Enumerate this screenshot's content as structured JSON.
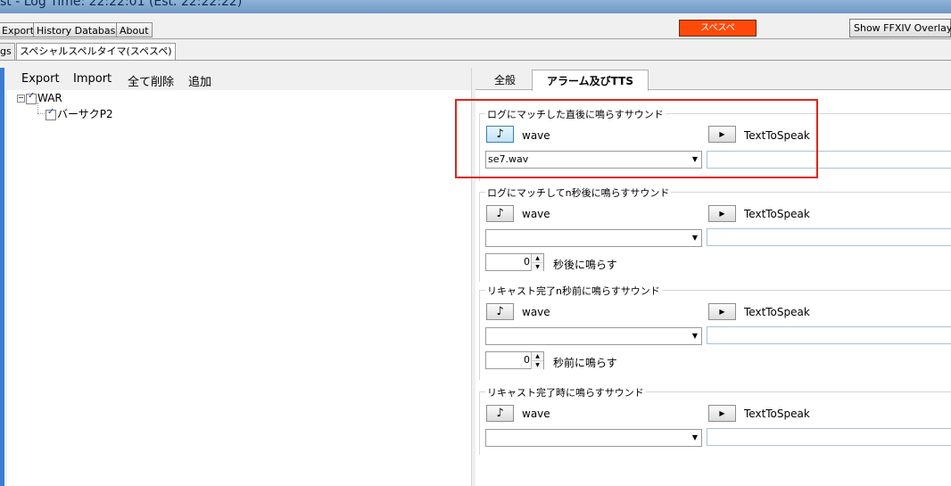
{
  "window": {
    "title_fragment": "st - Log Time: 22:22:01 (Est. 22:22:22)"
  },
  "toolbar": {
    "export_label": "Export",
    "history_label": "History Database",
    "about_label": "About",
    "alert_label": "スペスペ",
    "overlay_label": "Show FFXIV Overlay",
    "colors": {
      "alert_bg": "#ff4a0a"
    }
  },
  "outer_tabs": {
    "partial_label": "gs",
    "active_label": "スペシャルスペルタイマ(スペスペ)"
  },
  "left_menu": {
    "export": "Export",
    "import": "Import",
    "delete_all": "全て削除",
    "add": "追加"
  },
  "tree": {
    "root": "WAR",
    "child": "バーサクP2"
  },
  "right_tabs": {
    "general": "全般",
    "alarm": "アラーム及びTTS"
  },
  "groups": [
    {
      "title": "ログにマッチした直後に鳴らすサウンド",
      "wave_label": "wave",
      "tts_label": "TextToSpeak",
      "wave_value": "se7.wav"
    },
    {
      "title": "ログにマッチしてn秒後に鳴らすサウンド",
      "wave_label": "wave",
      "tts_label": "TextToSpeak",
      "wave_value": "",
      "delay_value": "0",
      "delay_label": "秒後に鳴らす"
    },
    {
      "title": "リキャスト完了n秒前に鳴らすサウンド",
      "wave_label": "wave",
      "tts_label": "TextToSpeak",
      "wave_value": "",
      "delay_value": "0",
      "delay_label": "秒前に鳴らす"
    },
    {
      "title": "リキャスト完了時に鳴らすサウンド",
      "wave_label": "wave",
      "tts_label": "TextToSpeak",
      "wave_value": ""
    }
  ],
  "icons": {
    "play": "music-note-icon",
    "tts": "play-triangle-icon",
    "dropdown": "chevron-down-icon"
  }
}
